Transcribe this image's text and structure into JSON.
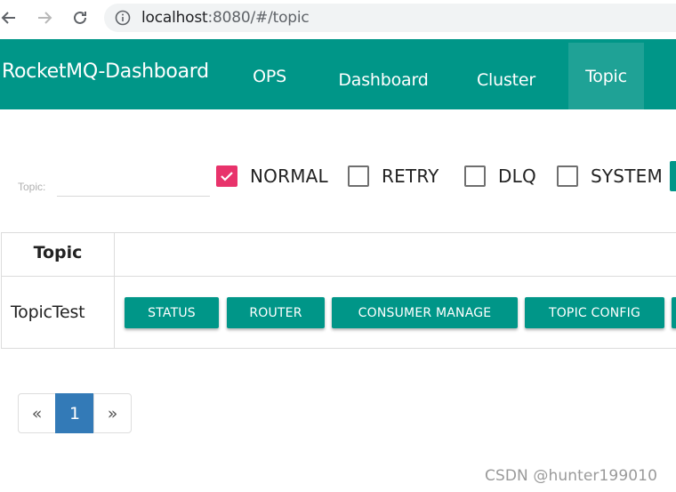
{
  "browser": {
    "url_host": "localhost",
    "url_rest": ":8080/#/topic"
  },
  "header": {
    "brand": "RocketMQ-Dashboard",
    "nav": [
      {
        "label": "OPS"
      },
      {
        "label": "Dashboard"
      },
      {
        "label": "Cluster"
      },
      {
        "label": "Topic",
        "active": true
      }
    ]
  },
  "filters": {
    "topic_label": "Topic:",
    "topic_value": "",
    "checkboxes": [
      {
        "label": "NORMAL",
        "checked": true
      },
      {
        "label": "RETRY",
        "checked": false
      },
      {
        "label": "DLQ",
        "checked": false
      },
      {
        "label": "SYSTEM",
        "checked": false
      }
    ]
  },
  "table": {
    "header": "Topic",
    "rows": [
      {
        "topic": "TopicTest",
        "actions": [
          "STATUS",
          "ROUTER",
          "CONSUMER MANAGE",
          "TOPIC CONFIG"
        ]
      }
    ]
  },
  "pagination": {
    "prev": "«",
    "page": "1",
    "next": "»"
  },
  "watermark": "CSDN @hunter199010",
  "colors": {
    "primary": "#009688",
    "checkbox_checked": "#e8336b",
    "page_active": "#337ab7"
  }
}
